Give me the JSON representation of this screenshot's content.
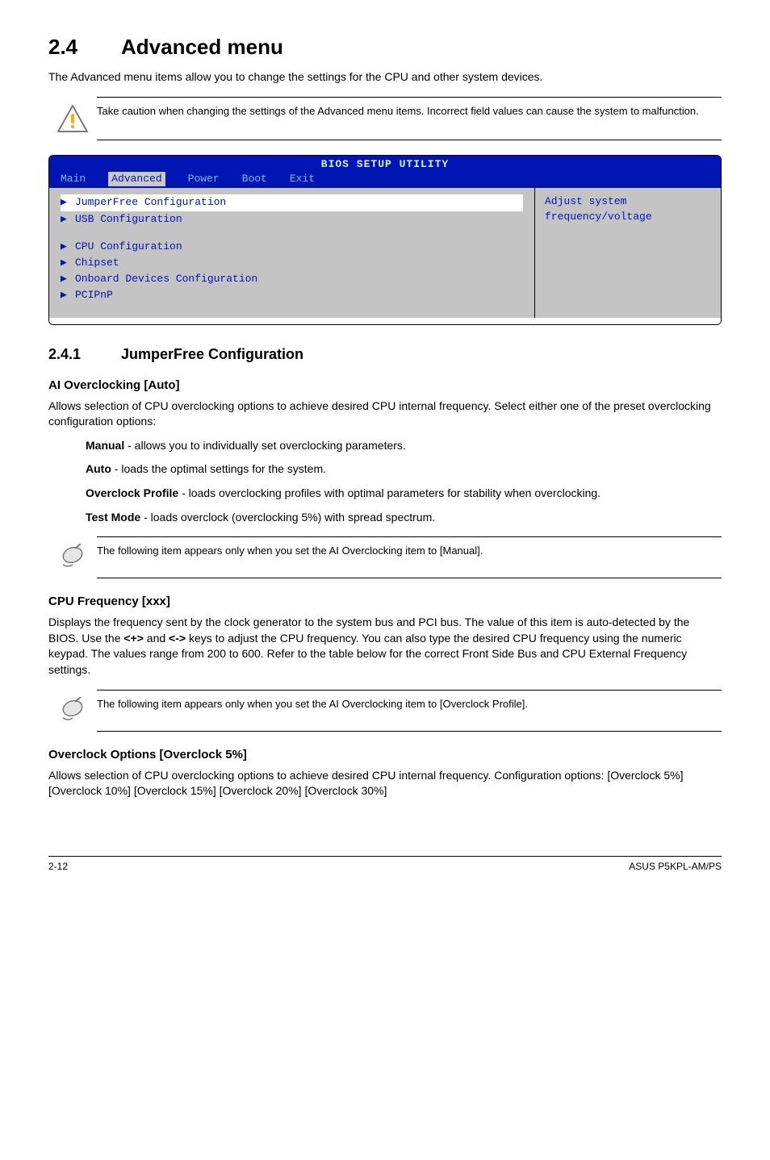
{
  "section": {
    "number": "2.4",
    "title": "Advanced menu"
  },
  "intro": "The Advanced menu items allow you to change the settings for the CPU and other system devices.",
  "caution": "Take caution when changing the settings of the Advanced menu items. Incorrect field values can cause the system to malfunction.",
  "bios": {
    "title": "BIOS SETUP UTILITY",
    "tabs": [
      "Main",
      "Advanced",
      "Power",
      "Boot",
      "Exit"
    ],
    "active_tab_index": 1,
    "group1": [
      {
        "label": "JumperFree Configuration",
        "selected": true
      },
      {
        "label": "USB Configuration",
        "selected": false
      }
    ],
    "group2": [
      {
        "label": "CPU Configuration"
      },
      {
        "label": "Chipset"
      },
      {
        "label": "Onboard Devices Configuration"
      },
      {
        "label": "PCIPnP"
      }
    ],
    "side_line1": "Adjust system",
    "side_line2": "frequency/voltage"
  },
  "subsection": {
    "number": "2.4.1",
    "title": "JumperFree Configuration"
  },
  "ai_overclocking": {
    "heading": "AI Overclocking [Auto]",
    "desc": "Allows selection of CPU overclocking options to achieve desired CPU internal frequency. Select either one of the preset overclocking configuration options:",
    "options": [
      {
        "lead": "Manual",
        "rest": " - allows you to individually set overclocking parameters."
      },
      {
        "lead": "Auto",
        "rest": " - loads the optimal settings for the system."
      },
      {
        "lead": "Overclock Profile",
        "rest": " - loads overclocking profiles with optimal parameters for stability when overclocking."
      },
      {
        "lead": "Test Mode",
        "rest": " - loads overclock (overclocking 5%) with spread spectrum."
      }
    ]
  },
  "note1": "The following item appears only when you set the AI Overclocking item to [Manual].",
  "cpu_freq": {
    "heading": "CPU Frequency [xxx]",
    "desc_pre": "Displays the frequency sent by the clock generator to the system bus and PCI bus. The value of this item is auto-detected by the BIOS. Use the ",
    "key1": "<+>",
    "mid": " and ",
    "key2": "<->",
    "desc_post": " keys to adjust the CPU frequency. You can also type the desired CPU frequency using the numeric keypad. The values range from 200 to 600. Refer to the table below for the correct Front Side Bus and CPU External Frequency settings."
  },
  "note2": "The following item appears only when you set the AI Overclocking item to [Overclock Profile].",
  "overclock_opts": {
    "heading": "Overclock Options [Overclock 5%]",
    "desc": "Allows selection of CPU overclocking options to achieve desired CPU internal frequency. Configuration options: [Overclock 5%] [Overclock 10%] [Overclock 15%] [Overclock 20%] [Overclock 30%]"
  },
  "footer": {
    "left": "2-12",
    "right": "ASUS P5KPL-AM/PS"
  }
}
